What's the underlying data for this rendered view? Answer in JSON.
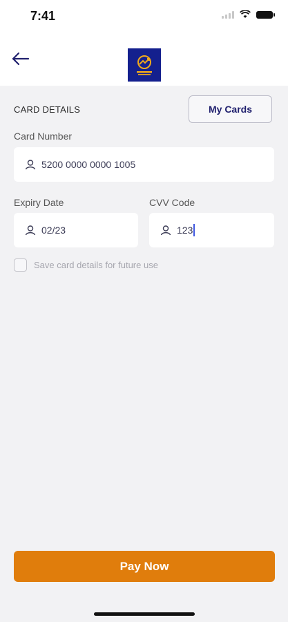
{
  "status_bar": {
    "time": "7:41",
    "icons": [
      "signal-icon",
      "wifi-icon",
      "battery-icon"
    ]
  },
  "header": {
    "back_icon": "arrow-left-icon",
    "logo_icon": "brand-logo"
  },
  "card_details": {
    "section_title": "CARD DETAILS",
    "my_cards_label": "My Cards",
    "card_number": {
      "label": "Card Number",
      "value": "5200 0000 0000 1005",
      "icon": "user-icon"
    },
    "expiry_date": {
      "label": "Expiry Date",
      "value": "02/23",
      "icon": "user-icon"
    },
    "cvv": {
      "label": "CVV Code",
      "value": "123",
      "icon": "user-icon"
    },
    "save_card": {
      "label": "Save card details for future use",
      "checked": false
    }
  },
  "pay_button_label": "Pay Now",
  "colors": {
    "accent": "#e07d0c",
    "brand": "#14208e",
    "background": "#f2f2f4"
  }
}
